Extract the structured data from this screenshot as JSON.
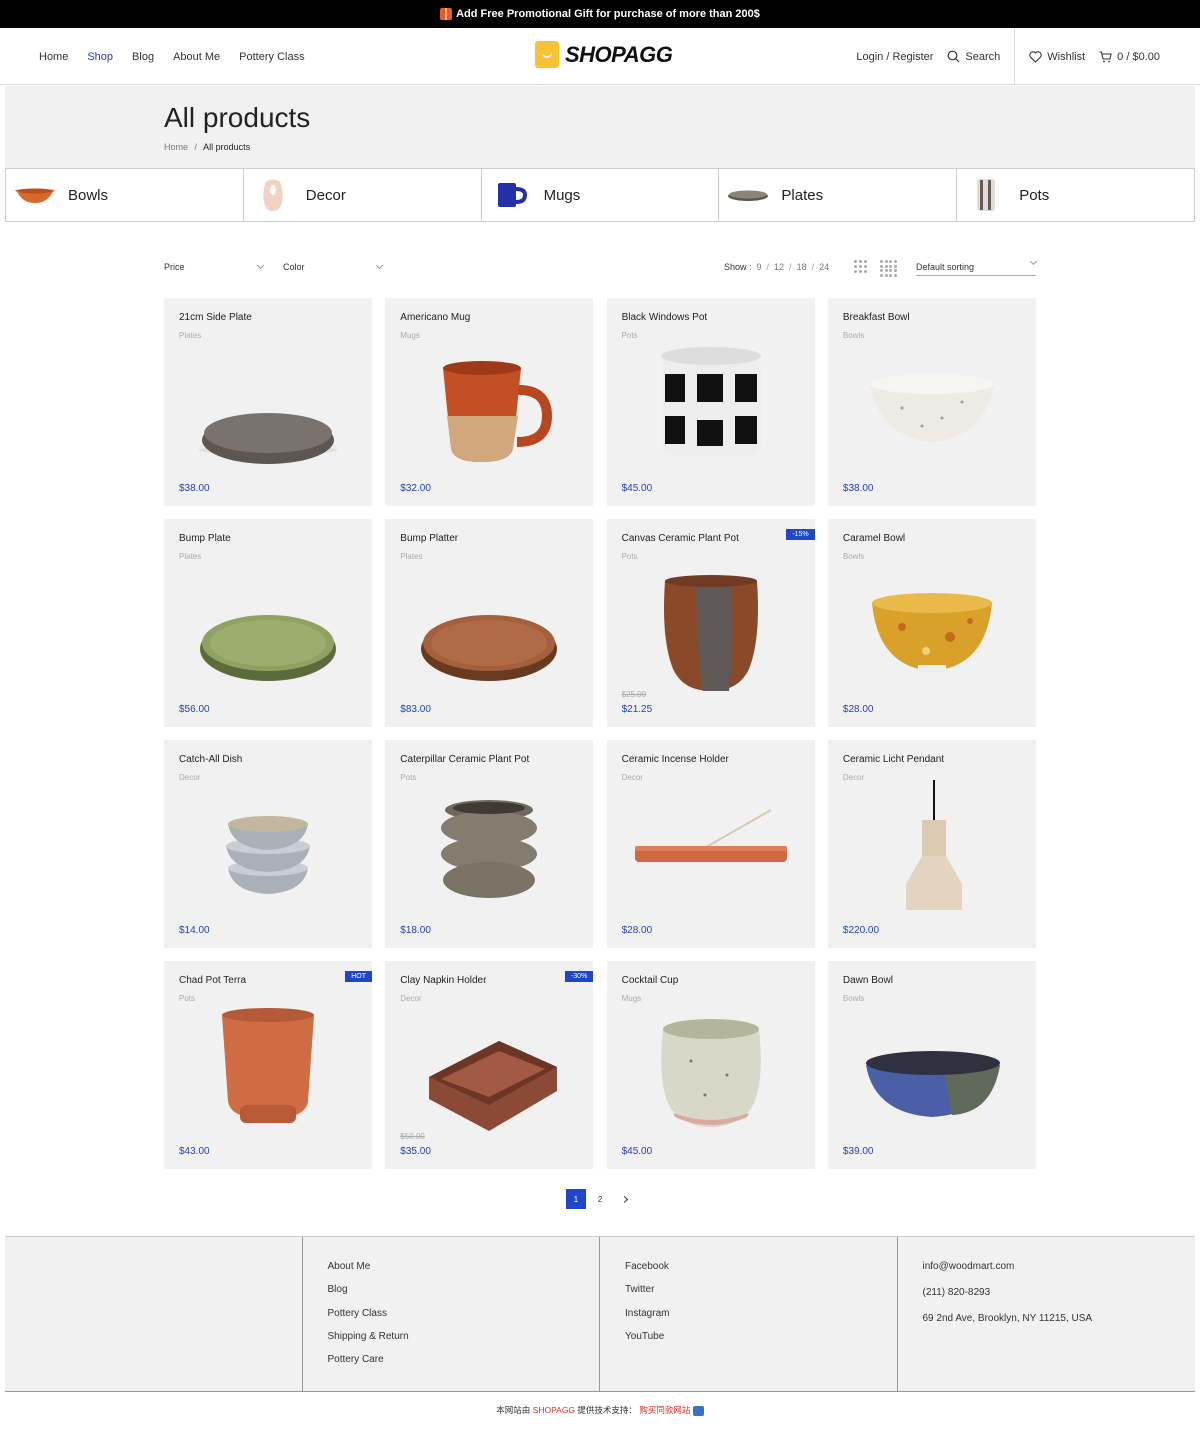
{
  "topbar": {
    "text": "Add Free Promotional Gift for purchase of more than 200$"
  },
  "header": {
    "nav": [
      "Home",
      "Shop",
      "Blog",
      "About Me",
      "Pottery Class"
    ],
    "active_nav": "Shop",
    "logo": "SHOPAGG",
    "login": "Login / Register",
    "search": "Search",
    "wishlist": "Wishlist",
    "cart": "0 / $0.00"
  },
  "page": {
    "title": "All products",
    "breadcrumb": {
      "home": "Home",
      "sep": "/",
      "current": "All products"
    }
  },
  "categories": [
    "Bowls",
    "Decor",
    "Mugs",
    "Plates",
    "Pots"
  ],
  "toolbar": {
    "price": "Price",
    "color": "Color",
    "show_label": "Show :",
    "show_options": [
      "9",
      "12",
      "18",
      "24"
    ],
    "sort": "Default sorting"
  },
  "products": [
    {
      "name": "21cm Side Plate",
      "category": "Plates",
      "price": "$38.00",
      "old_price": "",
      "badge": ""
    },
    {
      "name": "Americano Mug",
      "category": "Mugs",
      "price": "$32.00",
      "old_price": "",
      "badge": ""
    },
    {
      "name": "Black Windows Pot",
      "category": "Pots",
      "price": "$45.00",
      "old_price": "",
      "badge": ""
    },
    {
      "name": "Breakfast Bowl",
      "category": "Bowls",
      "price": "$38.00",
      "old_price": "",
      "badge": ""
    },
    {
      "name": "Bump Plate",
      "category": "Plates",
      "price": "$56.00",
      "old_price": "",
      "badge": ""
    },
    {
      "name": "Bump Platter",
      "category": "Plates",
      "price": "$83.00",
      "old_price": "",
      "badge": ""
    },
    {
      "name": "Canvas Ceramic Plant Pot",
      "category": "Pots",
      "price": "$21.25",
      "old_price": "$25.00",
      "badge": "-15%"
    },
    {
      "name": "Caramel Bowl",
      "category": "Bowls",
      "price": "$28.00",
      "old_price": "",
      "badge": ""
    },
    {
      "name": "Catch-All Dish",
      "category": "Decor",
      "price": "$14.00",
      "old_price": "",
      "badge": ""
    },
    {
      "name": "Caterpillar Ceramic Plant Pot",
      "category": "Pots",
      "price": "$18.00",
      "old_price": "",
      "badge": ""
    },
    {
      "name": "Ceramic Incense Holder",
      "category": "Decor",
      "price": "$28.00",
      "old_price": "",
      "badge": ""
    },
    {
      "name": "Ceramic Licht Pendant",
      "category": "Decor",
      "price": "$220.00",
      "old_price": "",
      "badge": ""
    },
    {
      "name": "Chad Pot Terra",
      "category": "Pots",
      "price": "$43.00",
      "old_price": "",
      "badge": "HOT"
    },
    {
      "name": "Clay Napkin Holder",
      "category": "Decor",
      "price": "$35.00",
      "old_price": "$50.00",
      "badge": "-30%"
    },
    {
      "name": "Cocktail Cup",
      "category": "Mugs",
      "price": "$45.00",
      "old_price": "",
      "badge": ""
    },
    {
      "name": "Dawn Bowl",
      "category": "Bowls",
      "price": "$39.00",
      "old_price": "",
      "badge": ""
    }
  ],
  "pagination": {
    "pages": [
      "1",
      "2"
    ],
    "current": "1"
  },
  "footer": {
    "links1": [
      "About Me",
      "Blog",
      "Pottery Class",
      "Shipping & Return",
      "Pottery Care"
    ],
    "links2": [
      "Facebook",
      "Twitter",
      "Instagram",
      "YouTube"
    ],
    "contact": [
      "info@woodmart.com",
      "(211) 820-8293",
      "69 2nd Ave, Brooklyn, NY 11215, USA"
    ]
  },
  "copyright": {
    "prefix": "本网站由",
    "brand": "SHOPAGG",
    "middle": "提供技术支持：",
    "link": "购买同款网站"
  },
  "colors": {
    "accent": "#2443b8",
    "badge": "#1e48c8",
    "panel": "#f1f1f1"
  }
}
